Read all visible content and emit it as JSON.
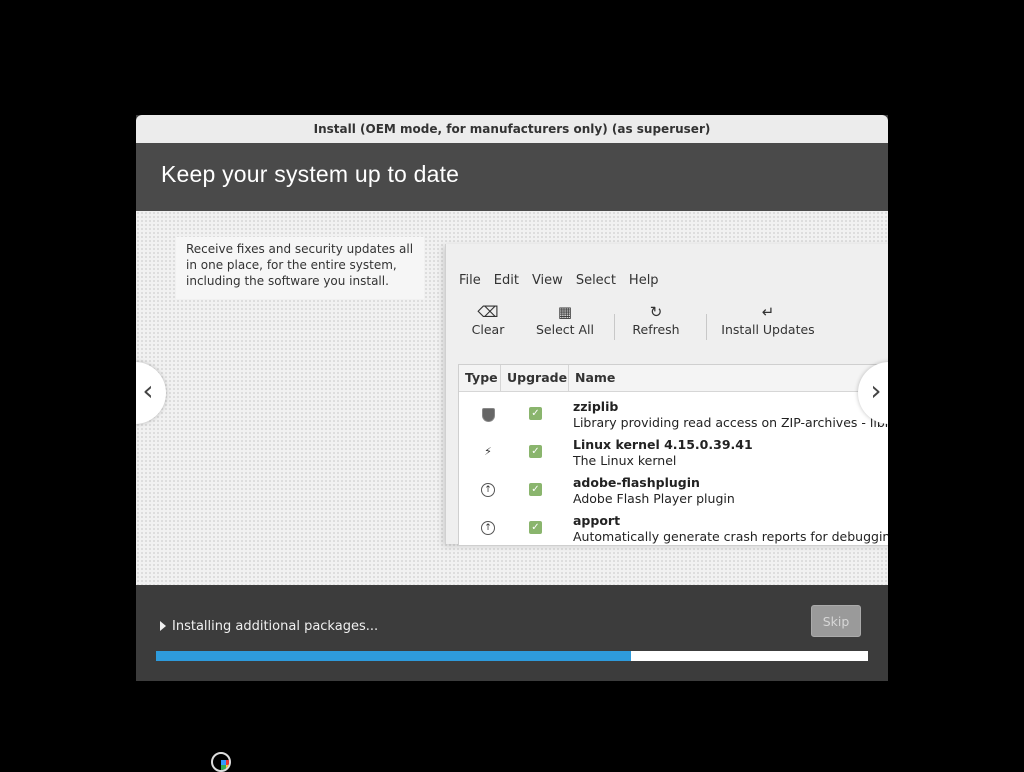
{
  "window": {
    "title": "Install (OEM mode, for manufacturers only) (as superuser)"
  },
  "header": {
    "title": "Keep your system up to date"
  },
  "slide": {
    "description": "Receive fixes and security updates all in one place, for the entire system, including the software you install.",
    "app": {
      "menu": [
        "File",
        "Edit",
        "View",
        "Select",
        "Help"
      ],
      "toolbar": {
        "clear": "Clear",
        "select_all": "Select All",
        "refresh": "Refresh",
        "install_updates": "Install Updates"
      },
      "columns": [
        "Type",
        "Upgrade",
        "Name"
      ],
      "rows": [
        {
          "type_icon": "shield-icon",
          "name": "zziplib",
          "desc": "Library providing read access on ZIP-archives - library"
        },
        {
          "type_icon": "lightning-icon",
          "name": "Linux kernel 4.15.0.39.41",
          "desc": "The Linux kernel"
        },
        {
          "type_icon": "up-arrow-icon",
          "name": "adobe-flashplugin",
          "desc": "Adobe Flash Player plugin"
        },
        {
          "type_icon": "up-arrow-icon",
          "name": "apport",
          "desc": "Automatically generate crash reports for debugging"
        }
      ]
    }
  },
  "footer": {
    "status": "Installing additional packages...",
    "skip_label": "Skip",
    "progress_fraction": 0.667
  },
  "colors": {
    "progress": "#2e9bdc",
    "checkbox": "#8ab56d"
  }
}
